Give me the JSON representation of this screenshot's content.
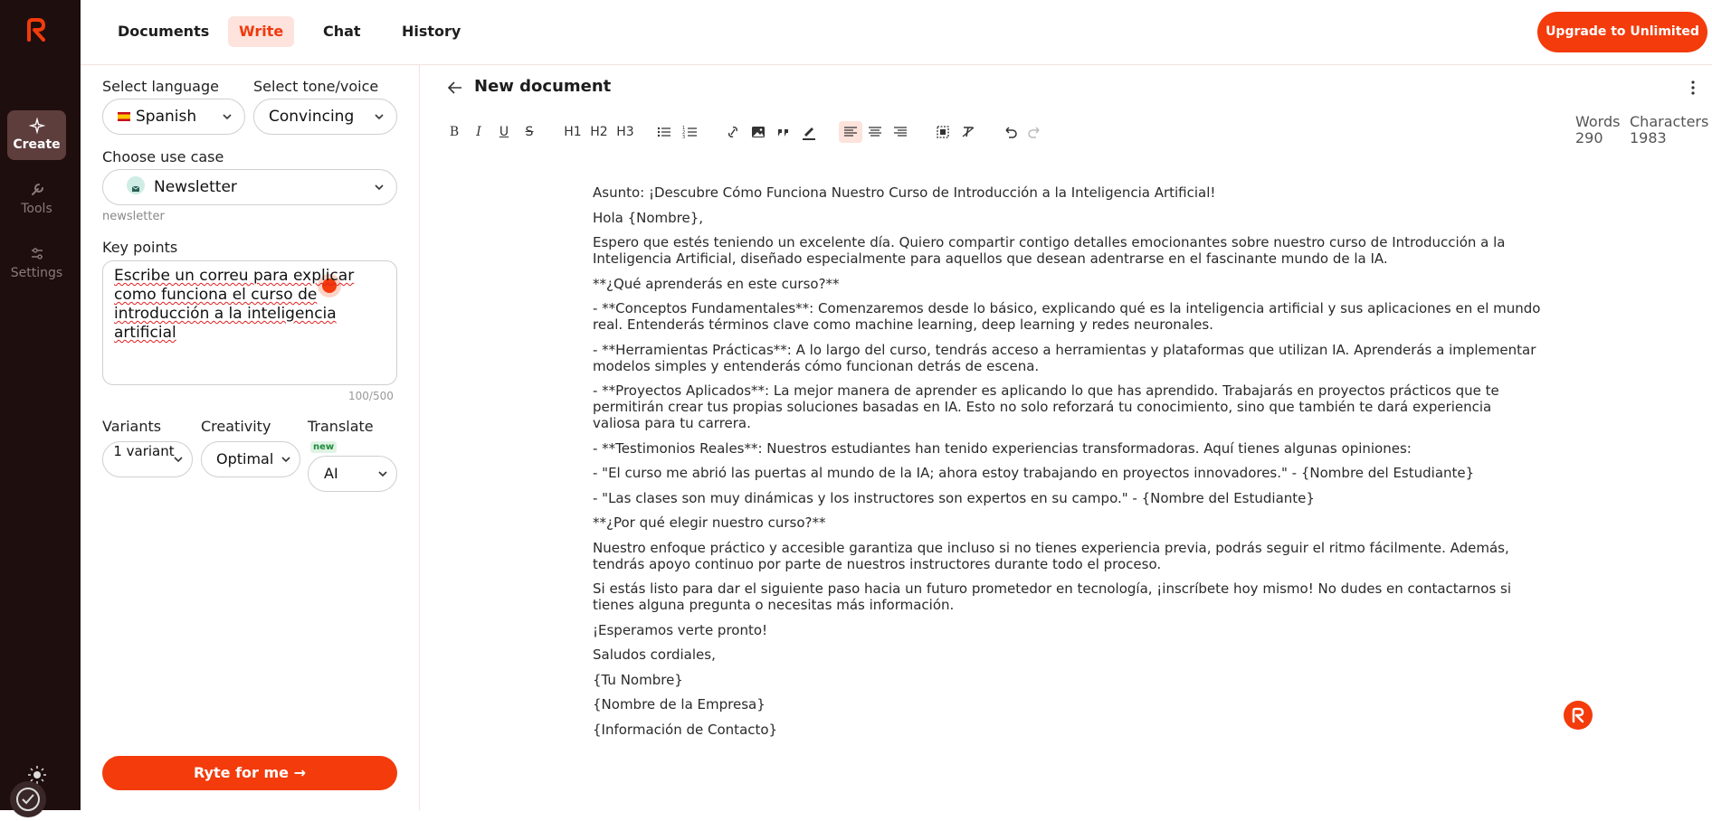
{
  "nav": {
    "rail_items": [
      {
        "label": "Create"
      },
      {
        "label": "Tools"
      },
      {
        "label": "Settings"
      }
    ],
    "tabs": [
      "Documents",
      "Write",
      "Chat",
      "History"
    ],
    "upgrade_label": "Upgrade to Unlimited"
  },
  "left": {
    "language_label": "Select language",
    "language_value": "Spanish",
    "tone_label": "Select tone/voice",
    "tone_value": "Convincing",
    "usecase_label": "Choose use case",
    "usecase_value": "Newsletter",
    "usecase_hint": "newsletter",
    "keypoints_label": "Key points",
    "keypoints_text": "Escribe un correu para explicar como funciona el curso de introducción a la inteligencia artificial",
    "keypoints_count": "100/500",
    "variants_label": "Variants",
    "variants_value": "1 variant",
    "creativity_label": "Creativity",
    "creativity_value": "Optimal",
    "translate_label": "Translate",
    "translate_badge": "new",
    "translate_value": "AI",
    "ryte_label": "Ryte for me →"
  },
  "editor": {
    "title": "New document",
    "toolbar": [
      "B",
      "I",
      "U",
      "S",
      "H1",
      "H2",
      "H3"
    ],
    "stats": {
      "words_label": "Words",
      "words": "290",
      "chars_label": "Characters",
      "chars": "1983"
    },
    "paragraphs": [
      "Asunto: ¡Descubre Cómo Funciona Nuestro Curso de Introducción a la Inteligencia Artificial!",
      "Hola {Nombre},",
      "Espero que estés teniendo un excelente día. Quiero compartir contigo detalles emocionantes sobre nuestro curso de Introducción a la Inteligencia Artificial, diseñado especialmente para aquellos que desean adentrarse en el fascinante mundo de la IA.",
      "**¿Qué aprenderás en este curso?**",
      "- **Conceptos Fundamentales**: Comenzaremos desde lo básico, explicando qué es la inteligencia artificial y sus aplicaciones en el mundo real. Entenderás términos clave como machine learning, deep learning y redes neuronales.",
      "- **Herramientas Prácticas**: A lo largo del curso, tendrás acceso a herramientas y plataformas que utilizan IA. Aprenderás a implementar modelos simples y entenderás cómo funcionan detrás de escena.",
      "- **Proyectos Aplicados**: La mejor manera de aprender es aplicando lo que has aprendido. Trabajarás en proyectos prácticos que te permitirán crear tus propias soluciones basadas en IA. Esto no solo reforzará tu conocimiento, sino que también te dará experiencia valiosa para tu carrera.",
      "- **Testimonios Reales**: Nuestros estudiantes han tenido experiencias transformadoras. Aquí tienes algunas opiniones:",
      "- \"El curso me abrió las puertas al mundo de la IA; ahora estoy trabajando en proyectos innovadores.\" - {Nombre del Estudiante}",
      "- \"Las clases son muy dinámicas y los instructores son expertos en su campo.\" - {Nombre del Estudiante}",
      "**¿Por qué elegir nuestro curso?**",
      "Nuestro enfoque práctico y accesible garantiza que incluso si no tienes experiencia previa, podrás seguir el ritmo fácilmente. Además, tendrás apoyo continuo por parte de nuestros instructores durante todo el proceso.",
      "Si estás listo para dar el siguiente paso hacia un futuro prometedor en tecnología, ¡inscríbete hoy mismo! No dudes en contactarnos si tienes alguna pregunta o necesitas más información.",
      "¡Esperamos verte pronto!",
      "Saludos cordiales,",
      "{Tu Nombre}",
      "{Nombre de la Empresa}",
      "{Información de Contacto}"
    ]
  },
  "colors": {
    "accent": "#f33b0c",
    "rail_bg": "#1f0e0e"
  }
}
